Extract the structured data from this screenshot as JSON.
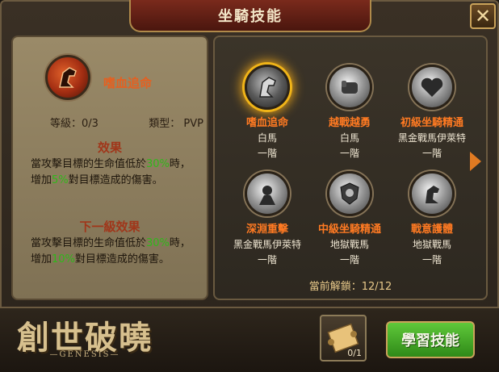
{
  "header": {
    "title": "坐騎技能",
    "close_label": "✕"
  },
  "selected_skill": {
    "name": "嗜血追命",
    "level_label": "等級：0/3",
    "type_label": "類型：",
    "type_value": "PVP",
    "effect_title": "效果",
    "effect_prefix": "當攻擊目標的生命值低於",
    "effect_threshold": "30%",
    "effect_middle": "時，增加",
    "effect_bonus": "5%",
    "effect_suffix": "對目標造成的傷害。",
    "next_title": "下一級效果",
    "next_prefix": "當攻擊目標的生命值低於",
    "next_threshold": "30%",
    "next_middle": "時，增加",
    "next_bonus": "10%",
    "next_suffix": "對目標造成的傷害。"
  },
  "skills": [
    {
      "name": "嗜血追命",
      "mount": "白馬",
      "tier": "一階",
      "icon": "horse-head-icon"
    },
    {
      "name": "越戰越勇",
      "mount": "白馬",
      "tier": "一階",
      "icon": "fist-icon"
    },
    {
      "name": "初級坐騎精通",
      "mount": "黑金戰馬伊萊特",
      "tier": "一階",
      "icon": "heart-icon"
    },
    {
      "name": "深淵重擊",
      "mount": "黑金戰馬伊萊特",
      "tier": "一階",
      "icon": "strike-icon"
    },
    {
      "name": "中級坐騎精通",
      "mount": "地獄戰馬",
      "tier": "一階",
      "icon": "shield-icon"
    },
    {
      "name": "戰意護體",
      "mount": "地獄戰馬",
      "tier": "一階",
      "icon": "horse-icon"
    }
  ],
  "unlock_text": "當前解鎖：12/12",
  "footer": {
    "logo_text": "創世破曉",
    "logo_sub": "—GENESIS—",
    "scroll_count": "0/1",
    "learn_button": "學習技能"
  },
  "colors": {
    "accent": "#ff7a22",
    "green": "#2fb81a",
    "learn_green": "#4db82a"
  }
}
